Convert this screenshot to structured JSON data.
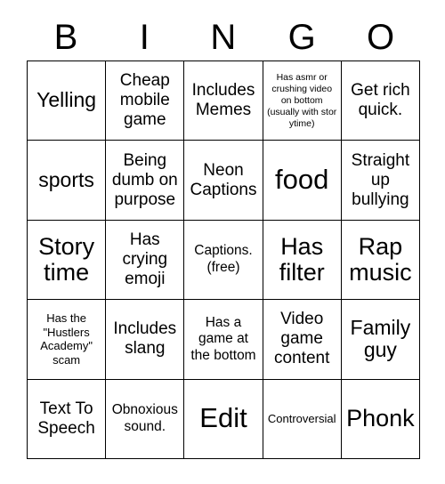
{
  "card": {
    "title": "BINGO",
    "header_letters": [
      "B",
      "I",
      "N",
      "G",
      "O"
    ],
    "grid_size": "5x5",
    "colors": {
      "text": "#000000",
      "background": "#ffffff",
      "gridline": "#000000"
    },
    "cells": [
      {
        "text": "Yelling",
        "size": "lg"
      },
      {
        "text": "Cheap mobile game",
        "size": "md"
      },
      {
        "text": "Includes Memes",
        "size": "md"
      },
      {
        "text": "Has asmr or crushing video on bottom (usually with stor ytime)",
        "size": "xxs"
      },
      {
        "text": "Get rich quick.",
        "size": "md"
      },
      {
        "text": "sports",
        "size": "lg"
      },
      {
        "text": "Being dumb on purpose",
        "size": "md"
      },
      {
        "text": "Neon Captions",
        "size": "md"
      },
      {
        "text": "food",
        "size": "xxl"
      },
      {
        "text": "Straight up bullying",
        "size": "md"
      },
      {
        "text": "Story time",
        "size": "xl"
      },
      {
        "text": "Has crying emoji",
        "size": "md"
      },
      {
        "text": "Captions. (free)",
        "size": "sm"
      },
      {
        "text": "Has filter",
        "size": "xl"
      },
      {
        "text": "Rap music",
        "size": "xl"
      },
      {
        "text": "Has the \"Hustlers Academy\" scam",
        "size": "xs"
      },
      {
        "text": "Includes slang",
        "size": "md"
      },
      {
        "text": "Has a game at the bottom",
        "size": "sm"
      },
      {
        "text": "Video game content",
        "size": "md"
      },
      {
        "text": "Family guy",
        "size": "lg"
      },
      {
        "text": "Text To Speech",
        "size": "md"
      },
      {
        "text": "Obnoxious sound.",
        "size": "sm"
      },
      {
        "text": "Edit",
        "size": "xxl"
      },
      {
        "text": "Controversial",
        "size": "xs"
      },
      {
        "text": "Phonk",
        "size": "xl"
      }
    ]
  }
}
